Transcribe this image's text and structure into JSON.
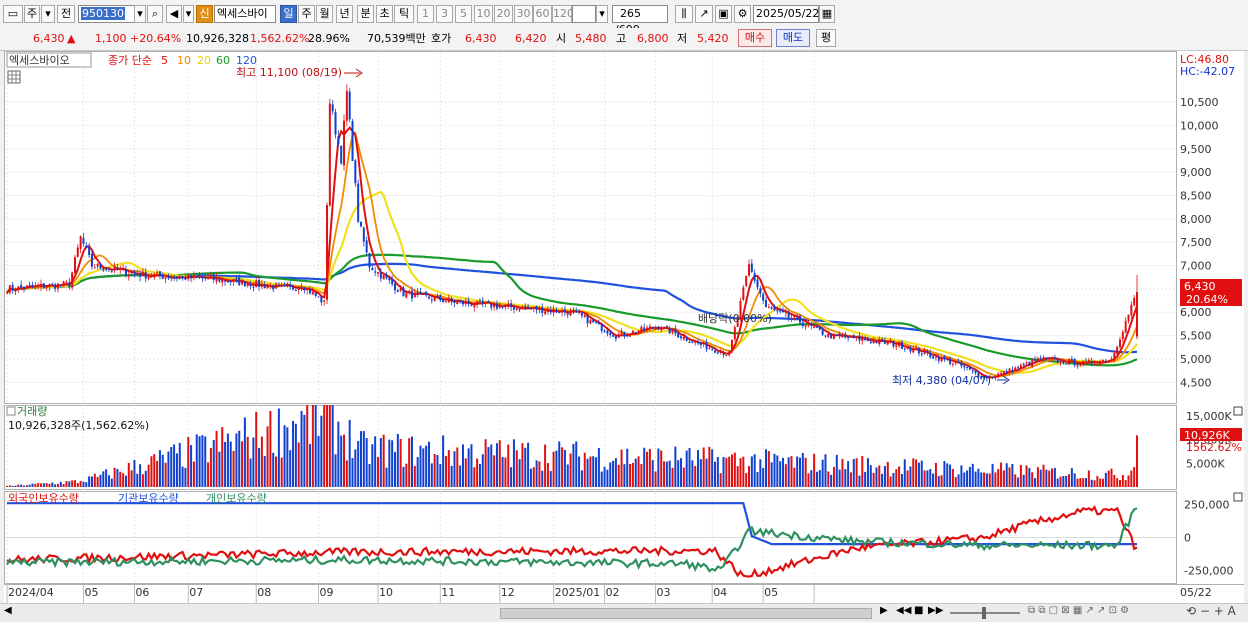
{
  "toolbar": {
    "type_label": "주",
    "prev_label": "전",
    "code": "950130",
    "credit_badge": "신",
    "stock_name": "엑세스바이",
    "periods": [
      "일",
      "주",
      "월",
      "년",
      "분",
      "초",
      "틱"
    ],
    "active_period": "일",
    "intervals": [
      "1",
      "3",
      "5",
      "10",
      "20",
      "30",
      "60",
      "120"
    ],
    "count_value": "265",
    "count_total": "/600",
    "date": "2025/05/22"
  },
  "quote": {
    "price": "6,430",
    "direction_symbol": "▲",
    "change": "1,100",
    "change_pct": "+20.64%",
    "volume": "10,926,328",
    "volume_pct": "1,562.62%",
    "turnover": "28.96%",
    "amount": "70,539백만",
    "bid_label": "호가",
    "bid1": "6,430",
    "bid2": "6,420",
    "open_label": "시",
    "open": "5,480",
    "high_label": "고",
    "high": "6,800",
    "low_label": "저",
    "low": "5,420",
    "buy_label": "매수",
    "sell_label": "매도",
    "eval_label": "평"
  },
  "colors": {
    "up": "#e01010",
    "down": "#1040d0",
    "ma5": "#e01010",
    "ma10": "#f08c00",
    "ma20": "#f0e020",
    "ma60": "#1a9a2a",
    "ma120": "#2050e0",
    "foreign": "#2050e0",
    "institution": "#e01010",
    "individual": "#2e9060"
  },
  "price_panel": {
    "name_tag": "엑세스바이오",
    "legend_prefix": "종가 단순",
    "ma_periods": [
      "5",
      "10",
      "20",
      "60",
      "120"
    ],
    "high_annot": "최고 11,100 (08/19)",
    "low_annot": "최저 4,380 (04/07)",
    "dividend_annot": "배당락(0.00%)",
    "lc": "LC:46.80",
    "hc": "HC:-42.07",
    "last_price": "6,430",
    "last_change": "20.64%"
  },
  "volume_panel": {
    "title": "거래량",
    "info": "10,926,328주(1,562.62%)",
    "last_tag": "10,926K",
    "last_pct": "1562.62%"
  },
  "holding_panel": {
    "legend": [
      "외국인보유수량",
      "기관보유수량",
      "개인보유수량"
    ]
  },
  "chart_data": [
    {
      "type": "candlestick",
      "title": "엑세스바이오",
      "ylabel": "",
      "x": [
        "2024/04",
        "05",
        "06",
        "07",
        "08",
        "09",
        "10",
        "11",
        "12",
        "2025/01",
        "02",
        "03",
        "04",
        "05",
        "05/22"
      ],
      "ylim": [
        4100,
        11550
      ],
      "yticks": [
        4500,
        5000,
        5500,
        6000,
        6500,
        7000,
        7500,
        8000,
        8500,
        9000,
        9500,
        10000,
        10500
      ],
      "series": [
        {
          "name": "종가",
          "values": [
            [
              0,
              6500
            ],
            [
              22,
              6600
            ],
            [
              26,
              7600
            ],
            [
              30,
              7000
            ],
            [
              48,
              6800
            ],
            [
              75,
              6700
            ],
            [
              100,
              6500
            ],
            [
              104,
              6600
            ],
            [
              112,
              6200
            ],
            [
              114,
              10500
            ],
            [
              118,
              9300
            ],
            [
              120,
              10700
            ],
            [
              124,
              8000
            ],
            [
              128,
              7000
            ],
            [
              140,
              6400
            ],
            [
              160,
              6200
            ],
            [
              180,
              6100
            ],
            [
              200,
              6000
            ],
            [
              215,
              5500
            ],
            [
              230,
              5700
            ],
            [
              245,
              5300
            ],
            [
              255,
              5100
            ],
            [
              262,
              7000
            ],
            [
              268,
              6100
            ],
            [
              280,
              5800
            ],
            [
              290,
              5500
            ],
            [
              305,
              5400
            ],
            [
              315,
              5300
            ],
            [
              325,
              5100
            ],
            [
              335,
              4900
            ],
            [
              345,
              4600
            ],
            [
              352,
              4700
            ],
            [
              365,
              5000
            ],
            [
              380,
              4900
            ],
            [
              390,
              5000
            ],
            [
              399,
              6430
            ]
          ]
        }
      ]
    },
    {
      "type": "bar",
      "title": "거래량",
      "ylabel": "",
      "yticks": [
        5000,
        10000,
        15000
      ],
      "unit": "K",
      "series": [
        {
          "name": "거래량",
          "values": [
            [
              0,
              200
            ],
            [
              26,
              1200
            ],
            [
              114,
              15000
            ],
            [
              116,
              13000
            ],
            [
              120,
              11000
            ],
            [
              124,
              8000
            ],
            [
              262,
              5500
            ],
            [
              396,
              2500
            ],
            [
              399,
              10926
            ]
          ]
        }
      ]
    },
    {
      "type": "line",
      "title": "",
      "yticks": [
        250000,
        0,
        -250000
      ],
      "series": [
        {
          "name": "외국인보유수량",
          "values": [
            [
              0,
              260000
            ],
            [
              260,
              260000
            ],
            [
              263,
              10000
            ],
            [
              270,
              -50000
            ],
            [
              399,
              -50000
            ],
            [
              400,
              -300000
            ]
          ]
        },
        {
          "name": "기관보유수량",
          "values": [
            [
              0,
              -170000
            ],
            [
              120,
              -110000
            ],
            [
              250,
              -100000
            ],
            [
              260,
              -300000
            ],
            [
              300,
              -80000
            ],
            [
              345,
              0
            ],
            [
              360,
              100000
            ],
            [
              380,
              200000
            ],
            [
              392,
              200000
            ],
            [
              399,
              -100000
            ]
          ]
        },
        {
          "name": "개인보유수량",
          "values": [
            [
              0,
              -190000
            ],
            [
              120,
              -170000
            ],
            [
              240,
              -200000
            ],
            [
              252,
              -250000
            ],
            [
              262,
              50000
            ],
            [
              300,
              -30000
            ],
            [
              345,
              -60000
            ],
            [
              392,
              -60000
            ],
            [
              399,
              250000
            ]
          ]
        }
      ]
    }
  ]
}
